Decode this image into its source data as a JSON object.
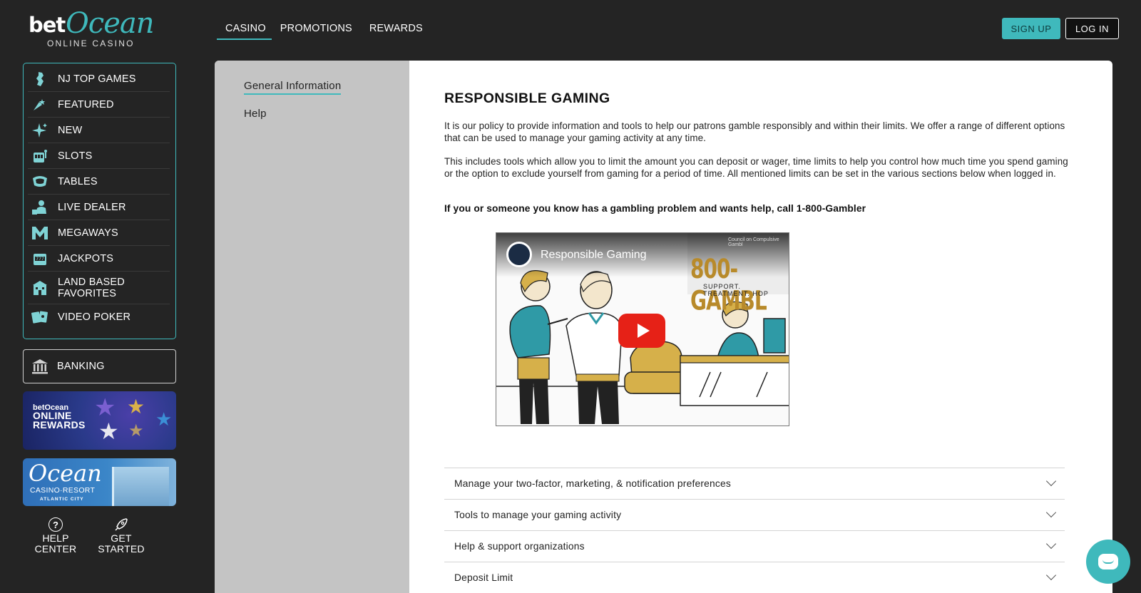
{
  "brand": {
    "prefix": "bet",
    "name": "Ocean",
    "tagline": "ONLINE CASINO"
  },
  "topnav": {
    "items": [
      {
        "label": "CASINO",
        "active": true
      },
      {
        "label": "PROMOTIONS",
        "active": false
      },
      {
        "label": "REWARDS",
        "active": false
      }
    ],
    "signup_label": "SIGN UP",
    "login_label": "LOG IN"
  },
  "sidebar": {
    "items": [
      {
        "label": "NJ TOP GAMES",
        "icon": "new-jersey-icon"
      },
      {
        "label": "FEATURED",
        "icon": "featured-icon"
      },
      {
        "label": "NEW",
        "icon": "sparkle-icon"
      },
      {
        "label": "SLOTS",
        "icon": "slot-machine-icon"
      },
      {
        "label": "TABLES",
        "icon": "table-icon"
      },
      {
        "label": "LIVE DEALER",
        "icon": "dealer-icon"
      },
      {
        "label": "MEGAWAYS",
        "icon": "megaways-icon"
      },
      {
        "label": "JACKPOTS",
        "icon": "jackpot-icon"
      },
      {
        "label": "LAND BASED FAVORITES",
        "icon": "casino-building-icon"
      },
      {
        "label": "VIDEO POKER",
        "icon": "cards-icon"
      }
    ],
    "banking_label": "BANKING",
    "promo_rewards": {
      "line1": "betOcean",
      "line2": "ONLINE",
      "line3": "REWARDS"
    },
    "promo_resort": {
      "name": "Ocean",
      "line1": "CASINO·RESORT",
      "line2": "ATLANTIC CITY"
    },
    "bottom": {
      "help_label": "HELP CENTER",
      "start_label": "GET STARTED"
    }
  },
  "leftnav": {
    "items": [
      {
        "label": "General Information",
        "active": true
      },
      {
        "label": "Help",
        "active": false
      }
    ]
  },
  "content": {
    "title": "RESPONSIBLE GAMING",
    "para1": "It is our policy to provide information and tools to help our patrons gamble responsibly and within their limits. We offer a range of different options that can be used to manage your gaming activity at any time.",
    "para2": "This includes tools which allow you to limit the amount you can deposit or wager, time limits to help you control how much time you spend gaming or the option to exclude yourself from gaming for a period of time. All mentioned limits can be set in the various sections below when logged in.",
    "helpline": "If you or someone you know has a gambling problem and wants help, call 1-800-Gambler",
    "video": {
      "title": "Responsible Gaming",
      "headline": "800-GAMBL",
      "subline": "SUPPORT. TREATMENT. HOP",
      "tiny": "Council on Compulsive Gambl"
    },
    "accordion": [
      "Manage your two-factor, marketing, & notification preferences",
      "Tools to manage your gaming activity",
      "Help & support organizations",
      "Deposit Limit"
    ]
  },
  "colors": {
    "accent": "#3fb9bc",
    "background": "#242424",
    "youtube_red": "#e62117"
  }
}
